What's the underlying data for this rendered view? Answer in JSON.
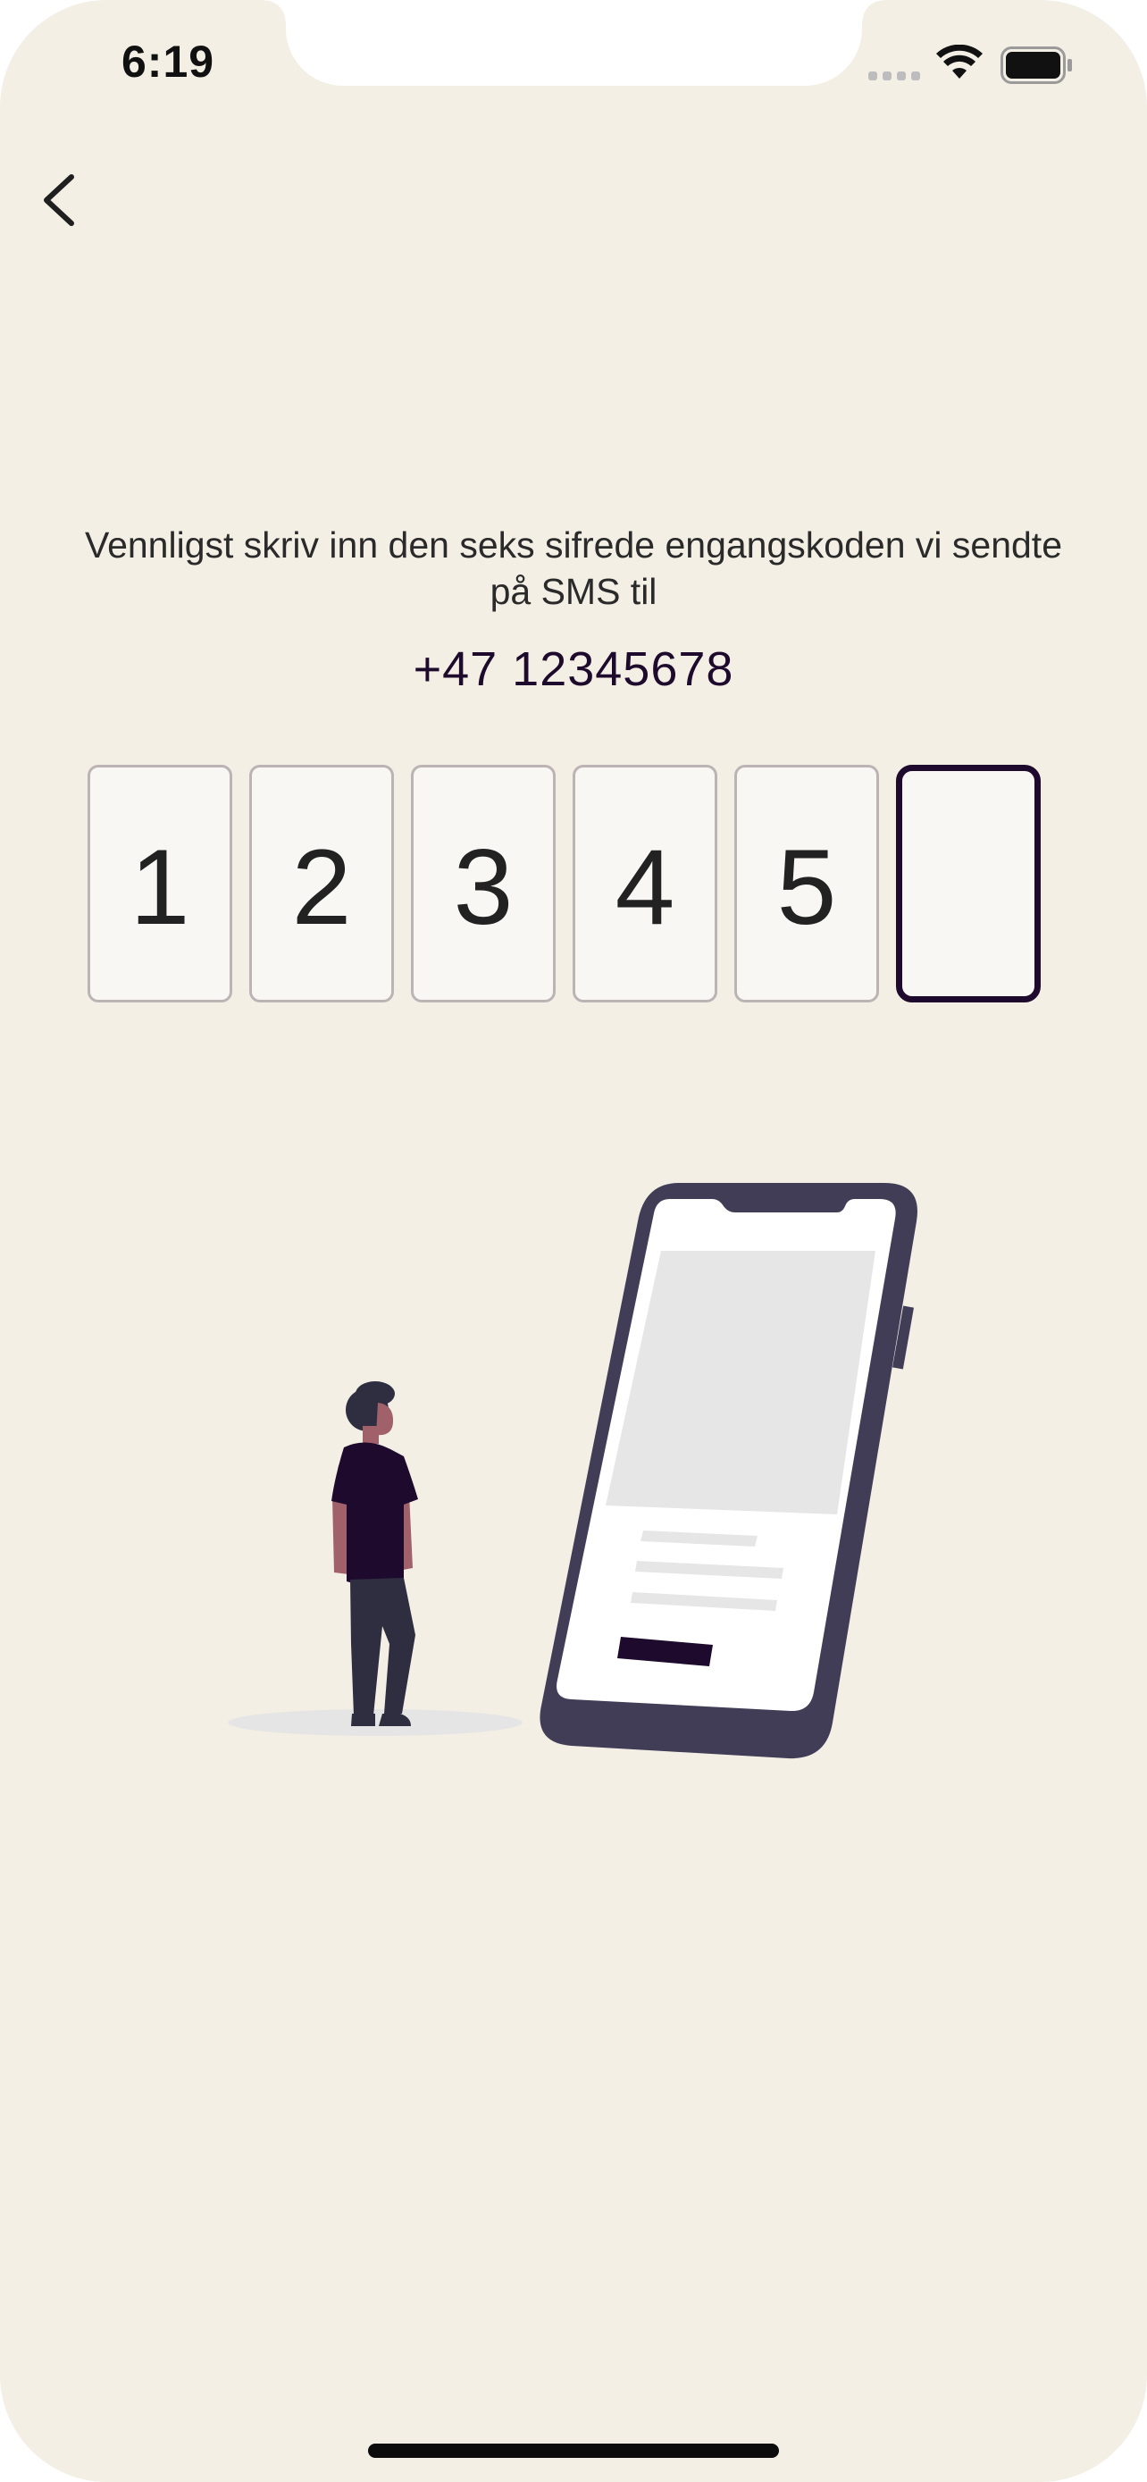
{
  "status_bar": {
    "time": "6:19"
  },
  "navigation": {
    "back_icon": "chevron-left-icon"
  },
  "verification": {
    "instruction": "Vennligst skriv inn den seks sifrede engangskoden vi sendte på SMS til",
    "phone_number": "+47 12345678",
    "code_digits": [
      "1",
      "2",
      "3",
      "4",
      "5",
      ""
    ]
  },
  "colors": {
    "background": "#f3efe5",
    "accent": "#1e0a2c",
    "box_border": "#bcb4b4",
    "box_fill": "#f8f7f4"
  }
}
